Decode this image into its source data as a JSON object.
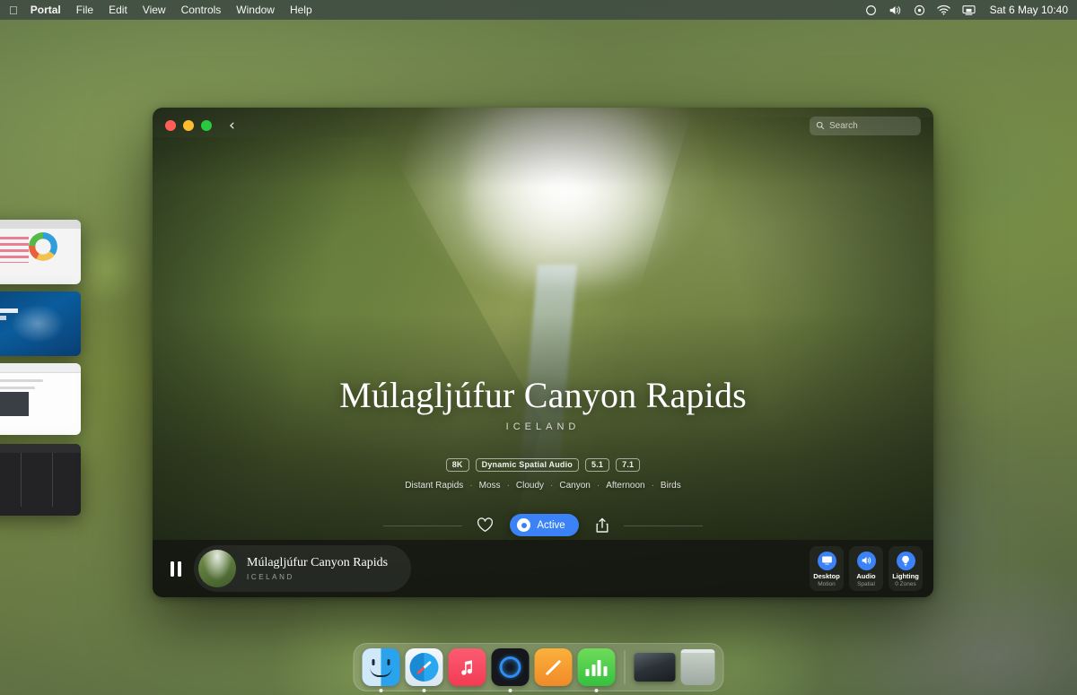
{
  "menubar": {
    "apple_icon": "apple-logo",
    "items": [
      {
        "label": "Portal",
        "bold": true
      },
      {
        "label": "File"
      },
      {
        "label": "Edit"
      },
      {
        "label": "View"
      },
      {
        "label": "Controls"
      },
      {
        "label": "Window"
      },
      {
        "label": "Help"
      }
    ],
    "status_icons": [
      "focus-circle-icon",
      "volume-icon",
      "control-center-icon",
      "wifi-icon",
      "screen-mirroring-icon"
    ],
    "clock": "Sat 6 May  10:40"
  },
  "window": {
    "traffic_lights": [
      "close-button",
      "minimize-button",
      "zoom-button"
    ],
    "back_label": "‹",
    "search": {
      "placeholder": "Search",
      "icon": "search-icon"
    }
  },
  "hero": {
    "title": "Múlagljúfur Canyon Rapids",
    "subtitle": "ICELAND",
    "badges": [
      "8K",
      "Dynamic Spatial Audio",
      "5.1",
      "7.1"
    ],
    "tags": [
      "Distant Rapids",
      "Moss",
      "Cloudy",
      "Canyon",
      "Afternoon",
      "Birds"
    ],
    "tag_separator": "·",
    "actions": {
      "favorite_icon": "heart-icon",
      "state_label": "Active",
      "state_icon": "record-dot-icon",
      "share_icon": "share-icon",
      "accent_color": "#3b82f6"
    }
  },
  "nowplaying": {
    "transport_icon": "pause-icon",
    "artwork": "canyon-thumbnail",
    "title": "Múlagljúfur Canyon Rapids",
    "subtitle": "ICELAND",
    "tiles": [
      {
        "icon": "display-icon",
        "label": "Desktop",
        "sub": "Motion"
      },
      {
        "icon": "speaker-icon",
        "label": "Audio",
        "sub": "Spatial"
      },
      {
        "icon": "lightbulb-icon",
        "label": "Lighting",
        "sub": "0 Zones"
      }
    ]
  },
  "dock": {
    "items": [
      {
        "name": "finder",
        "running": true
      },
      {
        "name": "safari",
        "running": true
      },
      {
        "name": "music",
        "running": false
      },
      {
        "name": "portal",
        "running": true
      },
      {
        "name": "notes",
        "running": false
      },
      {
        "name": "numbers",
        "running": true
      }
    ],
    "minimized_window": "portal-window-thumbnail",
    "trash": "trash-icon"
  },
  "minimized_windows": [
    {
      "app": "numbers",
      "badge_icon": "numbers-icon"
    },
    {
      "app": "keynote",
      "badge_icon": "notes-icon"
    },
    {
      "app": "safari",
      "badge_icon": "safari-icon"
    },
    {
      "app": "finder",
      "badge_icon": "finder-icon"
    }
  ]
}
